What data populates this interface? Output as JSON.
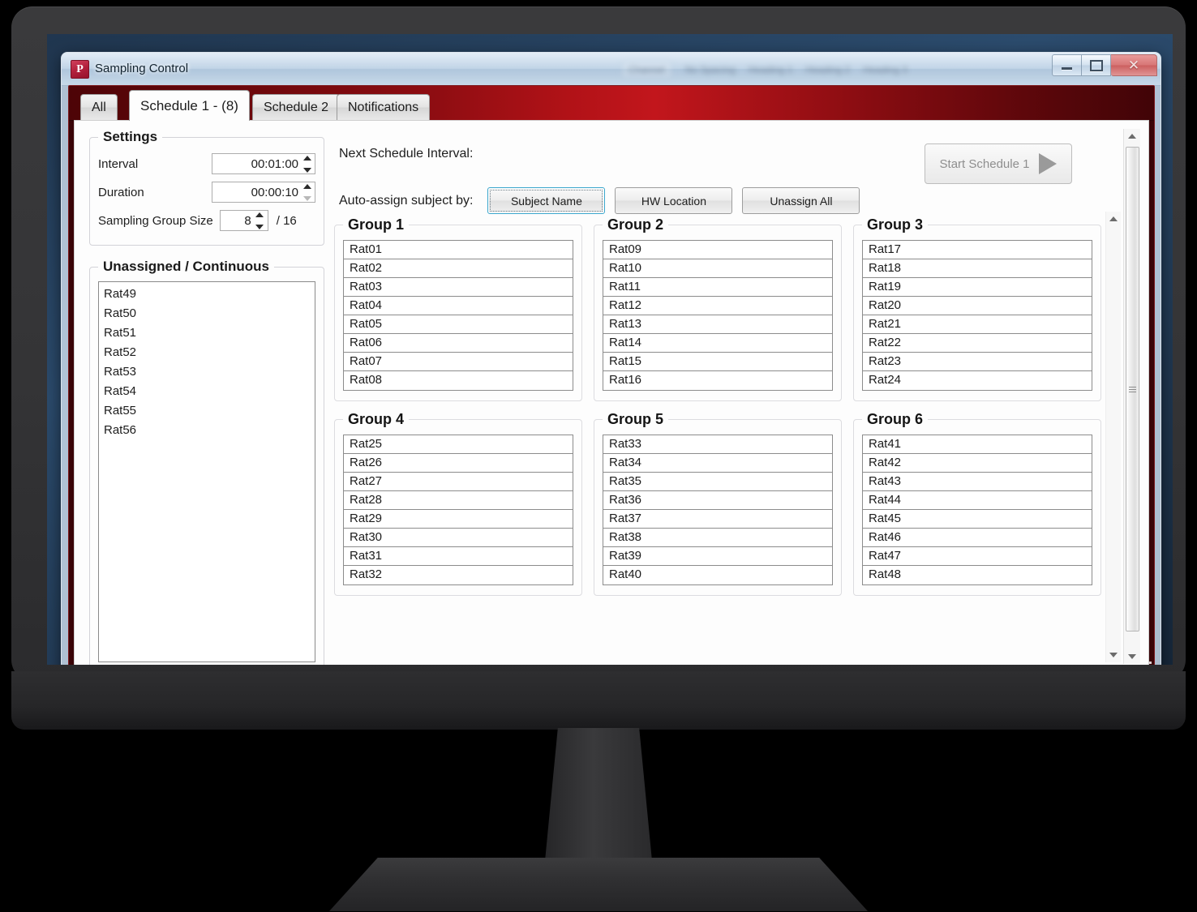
{
  "window": {
    "title": "Sampling Control",
    "icon": "powerpoint-p-icon",
    "minimize_label": "Minimize",
    "maximize_label": "Maximize",
    "close_label": "Close",
    "close_glyph": "✕",
    "icon_letter": "P"
  },
  "glass_ghost": {
    "items": [
      "Channel",
      "No Spacing",
      "Heading 1",
      "Heading 2",
      "Heading 3"
    ]
  },
  "tabs": [
    {
      "label": "All",
      "active": false
    },
    {
      "label": "Schedule 1 - (8)",
      "active": true
    },
    {
      "label": "Schedule 2",
      "active": false
    },
    {
      "label": "Notifications",
      "active": false
    }
  ],
  "settings": {
    "legend": "Settings",
    "interval_label": "Interval",
    "interval_value": "00:01:00",
    "duration_label": "Duration",
    "duration_value": "00:00:10",
    "group_size_label": "Sampling Group Size",
    "group_size_value": "8",
    "group_size_max": "/ 16"
  },
  "unassigned": {
    "legend": "Unassigned / Continuous",
    "items": [
      "Rat49",
      "Rat50",
      "Rat51",
      "Rat52",
      "Rat53",
      "Rat54",
      "Rat55",
      "Rat56"
    ]
  },
  "toolbar": {
    "next_interval_label": "Next Schedule Interval:",
    "next_interval_value": "",
    "autoassign_label": "Auto-assign subject by:",
    "subject_name_label": "Subject Name",
    "hw_location_label": "HW Location",
    "unassign_all_label": "Unassign All",
    "start_label": "Start Schedule 1",
    "start_icon": "play-triangle-icon"
  },
  "groups": [
    {
      "title": "Group 1",
      "items": [
        "Rat01",
        "Rat02",
        "Rat03",
        "Rat04",
        "Rat05",
        "Rat06",
        "Rat07",
        "Rat08"
      ]
    },
    {
      "title": "Group 2",
      "items": [
        "Rat09",
        "Rat10",
        "Rat11",
        "Rat12",
        "Rat13",
        "Rat14",
        "Rat15",
        "Rat16"
      ]
    },
    {
      "title": "Group 3",
      "items": [
        "Rat17",
        "Rat18",
        "Rat19",
        "Rat20",
        "Rat21",
        "Rat22",
        "Rat23",
        "Rat24"
      ]
    },
    {
      "title": "Group 4",
      "items": [
        "Rat25",
        "Rat26",
        "Rat27",
        "Rat28",
        "Rat29",
        "Rat30",
        "Rat31",
        "Rat32"
      ]
    },
    {
      "title": "Group 5",
      "items": [
        "Rat33",
        "Rat34",
        "Rat35",
        "Rat36",
        "Rat37",
        "Rat38",
        "Rat39",
        "Rat40"
      ]
    },
    {
      "title": "Group 6",
      "items": [
        "Rat41",
        "Rat42",
        "Rat43",
        "Rat44",
        "Rat45",
        "Rat46",
        "Rat47",
        "Rat48"
      ]
    }
  ],
  "colors": {
    "accent_red": "#b11217",
    "frame_dark_red": "#3a0508",
    "focus_blue": "#3ba6cc",
    "bezel": "#343436"
  }
}
